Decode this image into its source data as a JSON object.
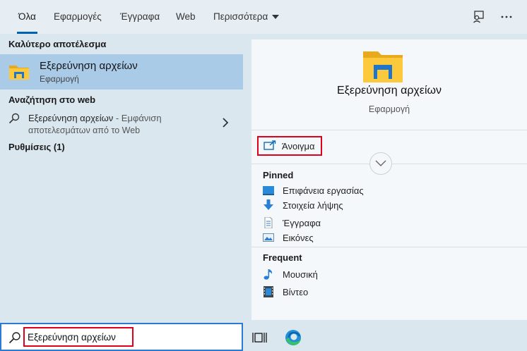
{
  "tabs": [
    {
      "label": "Όλα"
    },
    {
      "label": "Εφαρμογές"
    },
    {
      "label": "Έγγραφα"
    },
    {
      "label": "Web"
    },
    {
      "label": "Περισσότερα"
    }
  ],
  "top_icons": [
    "feedback-icon",
    "more-options-icon"
  ],
  "left": {
    "best_match_heading": "Καλύτερο αποτέλεσμα",
    "best_match": {
      "title": "Εξερεύνηση αρχείων",
      "subtitle": "Εφαρμογή",
      "icon": "folder-icon"
    },
    "web_heading": "Αναζήτηση στο web",
    "web_item": {
      "query": "Εξερεύνηση αρχείων",
      "suffix": " - Εμφάνιση",
      "line2": "αποτελεσμάτων από το Web"
    },
    "settings_heading": "Ρυθμίσεις (1)"
  },
  "right": {
    "app_name": "Εξερεύνηση αρχείων",
    "app_type": "Εφαρμογή",
    "open_label": "Άνοιγμα",
    "pinned_heading": "Pinned",
    "pinned": [
      {
        "label": "Επιφάνεια εργασίας",
        "icon": "desktop-icon"
      },
      {
        "label": "Στοιχεία λήψης",
        "icon": "downloads-icon"
      },
      {
        "label": "Έγγραφα",
        "icon": "documents-icon"
      },
      {
        "label": "Εικόνες",
        "icon": "pictures-icon"
      }
    ],
    "frequent_heading": "Frequent",
    "frequent": [
      {
        "label": "Μουσική",
        "icon": "music-icon"
      },
      {
        "label": "Βίντεο",
        "icon": "videos-icon"
      }
    ]
  },
  "taskbar": {
    "search_value": "Εξερεύνηση αρχείων",
    "icons": [
      "task-view-icon",
      "edge-icon"
    ]
  },
  "colors": {
    "accent": "#0063b1",
    "highlight": "#a9cbe8",
    "annotation": "#e0001b"
  }
}
